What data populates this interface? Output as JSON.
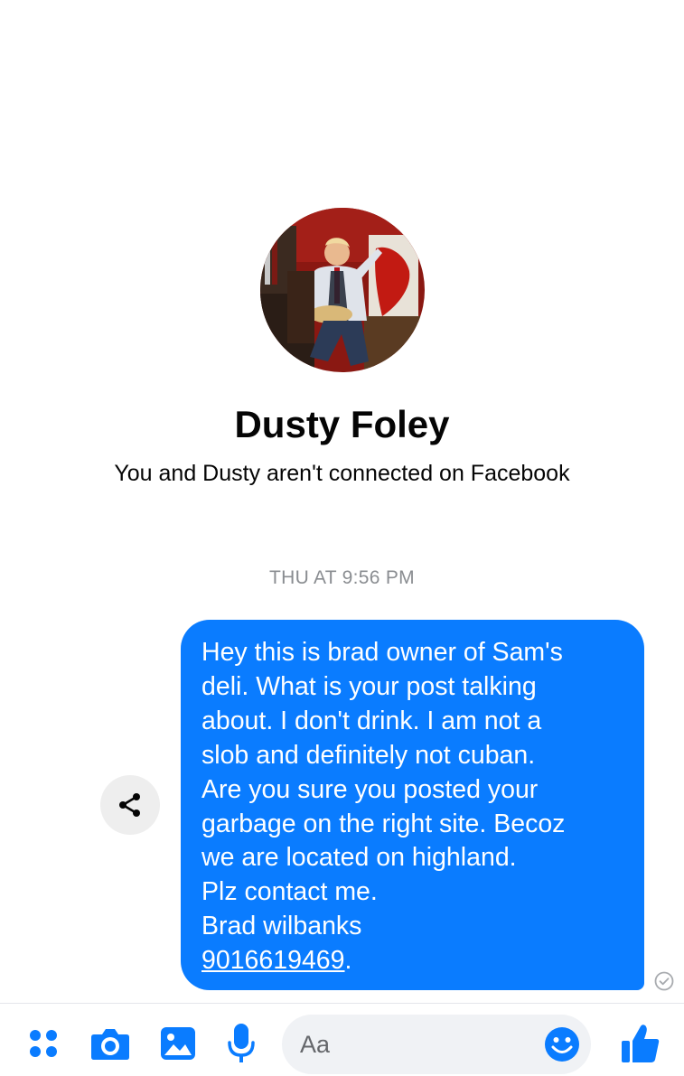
{
  "profile": {
    "name": "Dusty Foley",
    "connection_note": "You and Dusty aren't connected on Facebook"
  },
  "conversation": {
    "timestamp": "THU AT 9:56 PM",
    "message": {
      "lines": [
        "Hey this is brad owner of Sam's",
        "deli. What is your post talking",
        "about. I don't drink. I am not a",
        "slob and definitely not cuban.",
        "Are you sure you posted your",
        "garbage on the right site. Becoz",
        "we are located on highland.",
        "Plz contact me.",
        "Brad wilbanks"
      ],
      "phone": "9016619469",
      "phone_suffix": "."
    }
  },
  "composer": {
    "placeholder": "Aa",
    "tools": [
      "more-icon",
      "camera-icon",
      "gallery-icon",
      "microphone-icon",
      "emoji-icon",
      "thumbs-up-icon"
    ]
  },
  "colors": {
    "accent": "#0a7cff",
    "bubble_text": "#ffffff",
    "timestamp": "#8a8d91",
    "input_bg": "#f0f2f5"
  }
}
